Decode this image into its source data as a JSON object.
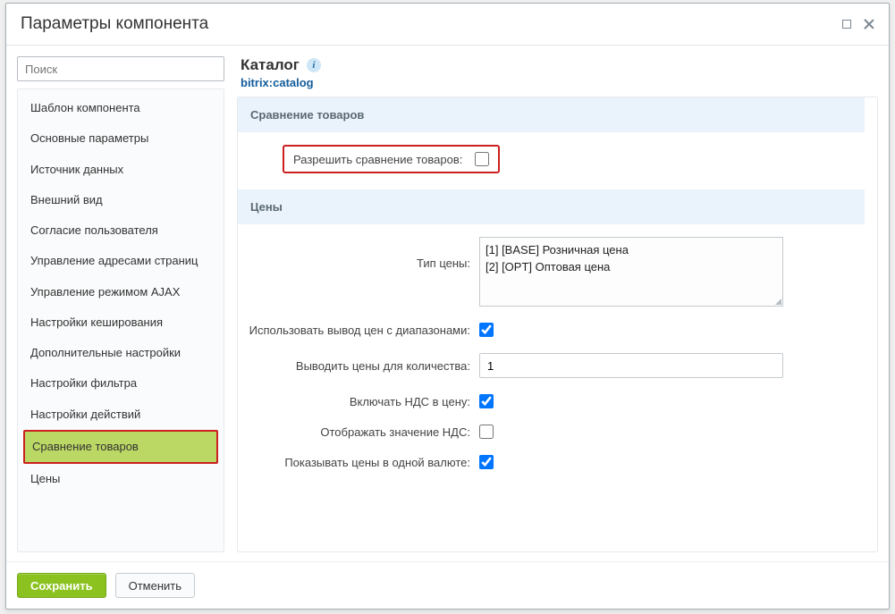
{
  "window": {
    "title": "Параметры компонента"
  },
  "search": {
    "placeholder": "Поиск"
  },
  "nav": {
    "items": [
      "Шаблон компонента",
      "Основные параметры",
      "Источник данных",
      "Внешний вид",
      "Согласие пользователя",
      "Управление адресами страниц",
      "Управление режимом AJAX",
      "Настройки кеширования",
      "Дополнительные настройки",
      "Настройки фильтра",
      "Настройки действий",
      "Сравнение товаров",
      "Цены"
    ],
    "activeIndex": 11
  },
  "main": {
    "title": "Каталог",
    "subtitle": "bitrix:catalog"
  },
  "sections": {
    "compare": {
      "title": "Сравнение товаров",
      "fields": {
        "allow_compare": {
          "label": "Разрешить сравнение товаров:",
          "checked": false
        }
      }
    },
    "prices": {
      "title": "Цены",
      "fields": {
        "price_type": {
          "label": "Тип цены:",
          "options": [
            "[1] [BASE] Розничная цена",
            "[2] [OPT] Оптовая цена"
          ]
        },
        "price_range": {
          "label": "Использовать вывод цен с диапазонами:",
          "checked": true
        },
        "price_qty": {
          "label": "Выводить цены для количества:",
          "value": "1"
        },
        "vat_include": {
          "label": "Включать НДС в цену:",
          "checked": true
        },
        "vat_show": {
          "label": "Отображать значение НДС:",
          "checked": false
        },
        "single_currency": {
          "label": "Показывать цены в одной валюте:",
          "checked": true
        }
      }
    }
  },
  "footer": {
    "save": "Сохранить",
    "cancel": "Отменить"
  }
}
